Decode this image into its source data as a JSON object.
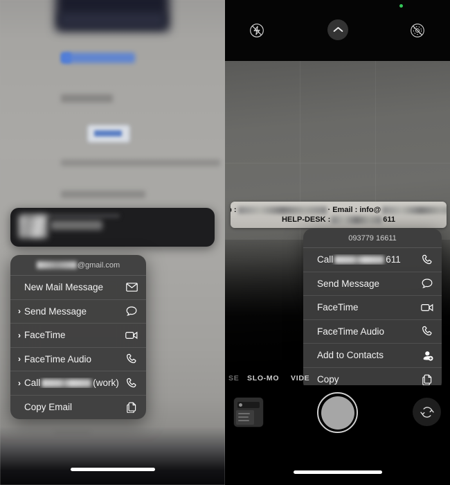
{
  "left_panel": {
    "name": "contact-long-press-menu-mail",
    "background_description": "blurred web page",
    "preview_bubble": {
      "name": "link-preview-bubble",
      "content": "redacted"
    },
    "menu": {
      "header": {
        "redacted_prefix": "redacted",
        "suffix": "@gmail.com"
      },
      "items": [
        {
          "label": "New Mail Message",
          "icon": "envelope-icon",
          "has_chevron": false
        },
        {
          "label": "Send Message",
          "icon": "message-bubble-icon",
          "has_chevron": true
        },
        {
          "label": "FaceTime",
          "icon": "video-camera-icon",
          "has_chevron": true
        },
        {
          "label": "FaceTime Audio",
          "icon": "phone-handset-icon",
          "has_chevron": true
        },
        {
          "label_prefix": "Call",
          "label_suffix": "(work)",
          "redacted": true,
          "icon": "phone-handset-icon",
          "has_chevron": true
        },
        {
          "label": "Copy Email",
          "icon": "copy-pages-icon",
          "has_chevron": false
        }
      ]
    }
  },
  "right_panel": {
    "name": "camera-live-text-menu",
    "top_controls": {
      "flash": "flash-off-icon",
      "expand": "chevron-up-icon",
      "live_photo": "live-photo-off-icon",
      "recording_dot": true
    },
    "banner": {
      "line1_label_web": "Web :",
      "line1_separator": "·",
      "line1_label_email": "Email : info@",
      "line2_label": "HELP-DESK :",
      "line2_value_suffix": "611"
    },
    "menu": {
      "header": "093779 16611",
      "items": [
        {
          "label_prefix": "Call",
          "label_suffix": "611",
          "redacted": true,
          "icon": "phone-handset-icon"
        },
        {
          "label": "Send Message",
          "icon": "message-bubble-icon"
        },
        {
          "label": "FaceTime",
          "icon": "video-camera-icon"
        },
        {
          "label": "FaceTime Audio",
          "icon": "phone-handset-icon"
        },
        {
          "label": "Add to Contacts",
          "icon": "person-add-icon"
        },
        {
          "label": "Copy",
          "icon": "copy-pages-icon"
        }
      ]
    },
    "camera_modes": [
      {
        "label": "SE",
        "active": false
      },
      {
        "label": "SLO-MO",
        "active": false
      },
      {
        "label": "VIDE",
        "active": false
      }
    ],
    "bottom_controls": {
      "thumbnail": "last-photo-thumbnail",
      "shutter": "shutter-button",
      "flip": "flip-camera-icon"
    }
  },
  "colors": {
    "menu_bg": "#3d3d3d",
    "menu_text": "#f2f2f2",
    "banner_bg": "#c6c4bf",
    "accent_green": "#34c759"
  }
}
